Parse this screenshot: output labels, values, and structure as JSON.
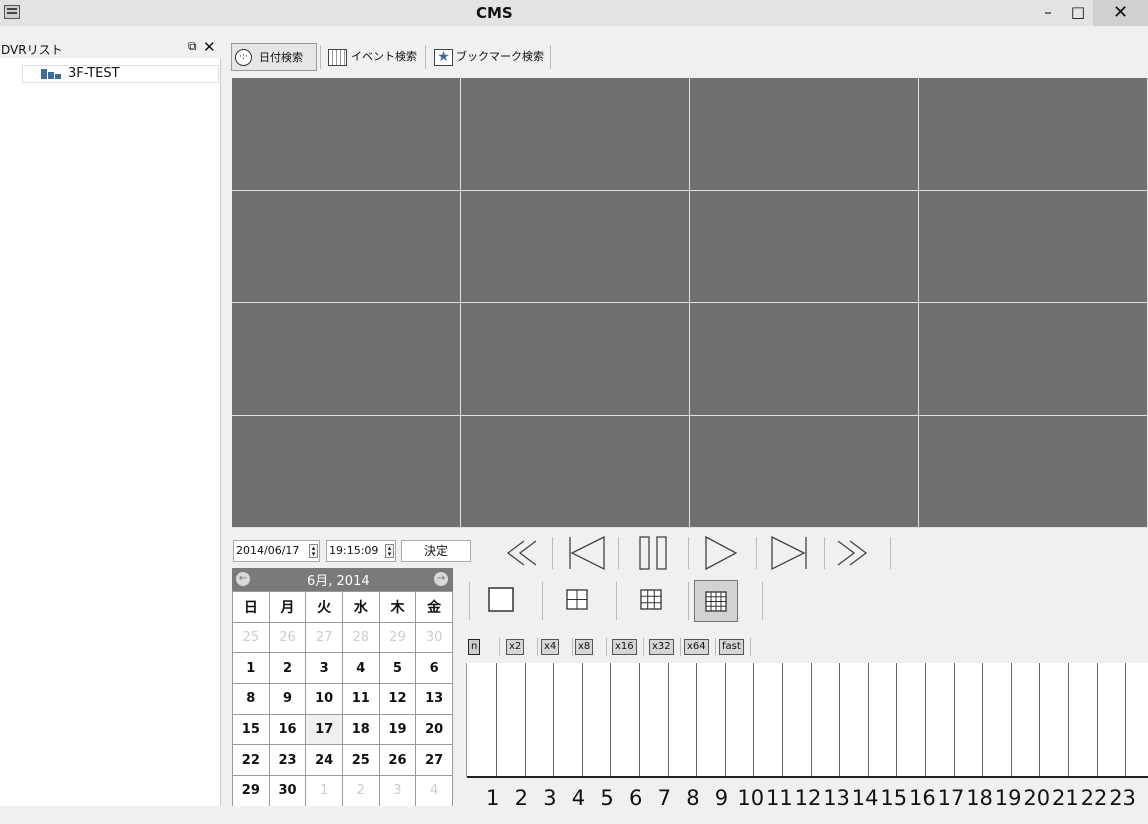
{
  "window": {
    "title": "CMS",
    "controls": {
      "minimize": "–",
      "maximize": "□",
      "close": "✕"
    }
  },
  "sidebar": {
    "title": "DVRリスト",
    "pin_icon": "⧉",
    "close_icon": "✕",
    "items": [
      {
        "label": "3F-TEST"
      }
    ]
  },
  "toolbar": {
    "date_search": "日付検索",
    "event_search": "イベント検索",
    "bookmark_search": "ブックマーク検索"
  },
  "datetime": {
    "date": "2014/06/17",
    "time": "19:15:09",
    "apply": "決定"
  },
  "calendar": {
    "month_label": "6月, 2014",
    "prev": "←",
    "next": "→",
    "weekdays": [
      "日",
      "月",
      "火",
      "水",
      "木",
      "金"
    ],
    "weeks": [
      [
        "25",
        "26",
        "27",
        "28",
        "29",
        "30"
      ],
      [
        "1",
        "2",
        "3",
        "4",
        "5",
        "6"
      ],
      [
        "8",
        "9",
        "10",
        "11",
        "12",
        "13"
      ],
      [
        "15",
        "16",
        "17",
        "18",
        "19",
        "20"
      ],
      [
        "22",
        "23",
        "24",
        "25",
        "26",
        "27"
      ],
      [
        "29",
        "30",
        "1",
        "2",
        "3",
        "4"
      ]
    ],
    "selected": "17"
  },
  "speeds": [
    "n",
    "x2",
    "x4",
    "x8",
    "x16",
    "x32",
    "x64",
    "fast"
  ],
  "timeline": {
    "hours": [
      "1",
      "2",
      "3",
      "4",
      "5",
      "6",
      "7",
      "8",
      "9",
      "10",
      "11",
      "12",
      "13",
      "14",
      "15",
      "16",
      "17",
      "18",
      "19",
      "20",
      "21",
      "22",
      "23"
    ]
  },
  "colors": {
    "video_tile": "#707070",
    "calendar_header": "#7a7a7a"
  }
}
